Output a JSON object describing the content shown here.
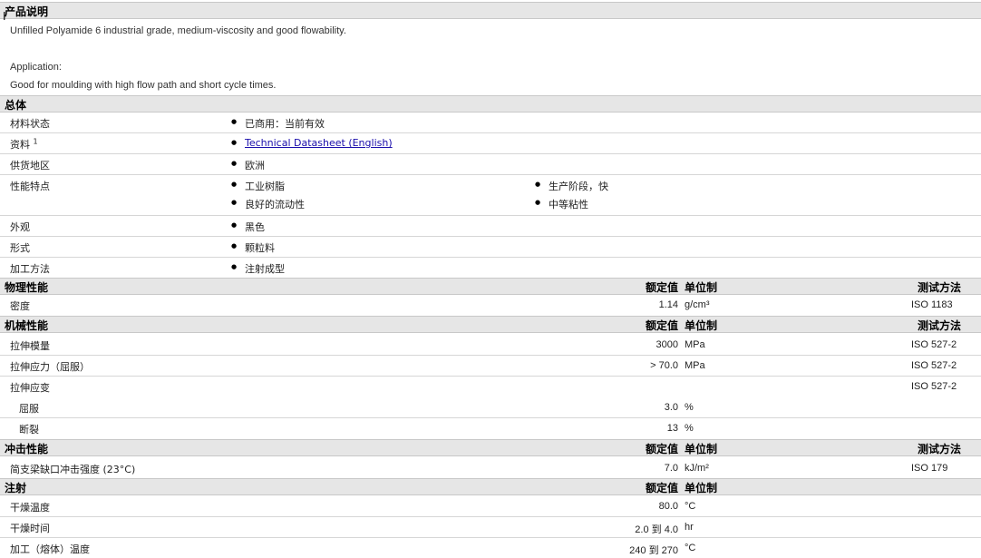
{
  "product_desc": {
    "title": "产品说明",
    "line1": "Unfilled Polyamide 6 industrial grade, medium-viscosity and good flowability.",
    "line2": "Application:",
    "line3": "Good for moulding with high flow path and short cycle times."
  },
  "general": {
    "title": "总体",
    "material_status_label": "材料状态",
    "material_status": "已商用：当前有效",
    "docs_label": "资料",
    "docs_sup": "1",
    "docs_link": "Technical Datasheet (English)",
    "availability_label": "供货地区",
    "availability": "欧洲",
    "features_label": "性能特点",
    "features": [
      "工业树脂",
      "生产阶段，快",
      "良好的流动性",
      "中等粘性"
    ],
    "appearance_label": "外观",
    "appearance": "黑色",
    "form_label": "形式",
    "form": "颗粒料",
    "process_label": "加工方法",
    "process": "注射成型"
  },
  "col_headers": {
    "nominal": "额定值",
    "unit": "单位制",
    "method": "测试方法"
  },
  "physical": {
    "title": "物理性能",
    "rows": [
      {
        "label": "密度",
        "value": "1.14",
        "unit": "g/cm³",
        "method": "ISO 1183"
      }
    ]
  },
  "mechanical": {
    "title": "机械性能",
    "rows": [
      {
        "label": "拉伸模量",
        "value": "3000",
        "unit": "MPa",
        "method": "ISO 527-2"
      },
      {
        "label": "拉伸应力（屈服）",
        "value": "> 70.0",
        "unit": "MPa",
        "method": "ISO 527-2"
      },
      {
        "label": "拉伸应变",
        "value": "",
        "unit": "",
        "method": "ISO 527-2"
      },
      {
        "label": "屈服",
        "value": "3.0",
        "unit": "%",
        "method": ""
      },
      {
        "label": "断裂",
        "value": "13",
        "unit": "%",
        "method": ""
      }
    ]
  },
  "impact": {
    "title": "冲击性能",
    "rows": [
      {
        "label": "简支梁缺口冲击强度 (23°C)",
        "value": "7.0",
        "unit": "kJ/m²",
        "method": "ISO 179"
      }
    ]
  },
  "injection": {
    "title": "注射",
    "rows": [
      {
        "label": "干燥温度",
        "value": "80.0",
        "unit": "°C"
      },
      {
        "label": "干燥时间",
        "value": "2.0 到  4.0",
        "unit": "hr"
      },
      {
        "label": "加工（熔体）温度",
        "value": "240 到  270",
        "unit": "°C"
      }
    ]
  }
}
